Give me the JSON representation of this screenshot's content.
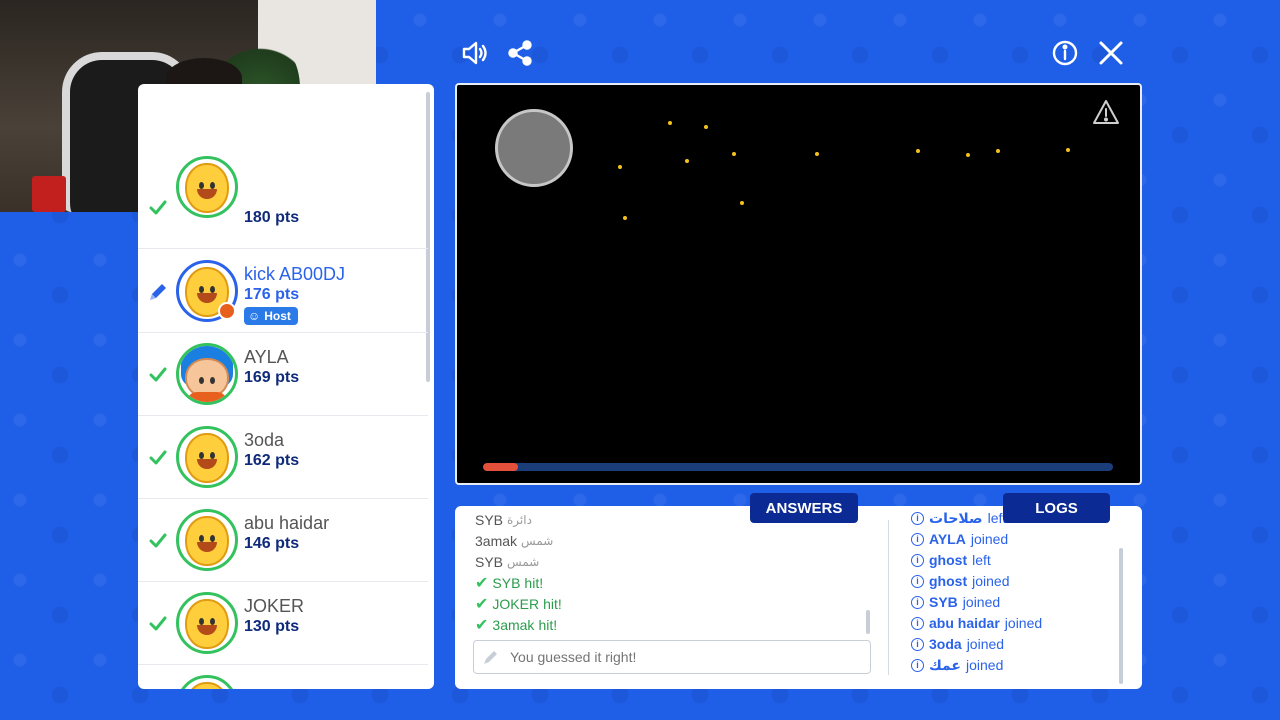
{
  "colors": {
    "background": "#1f5fe8",
    "accent": "#2a63ea",
    "correct": "#33c25e",
    "tab_bg": "#0c2a93",
    "points": "#0f2a7a",
    "timer_fill": "#e4503a"
  },
  "toolbar": {
    "left_icons": [
      "volume-icon",
      "share-icon"
    ],
    "right_icons": [
      "info-icon",
      "close-icon"
    ]
  },
  "players": [
    {
      "name": "",
      "points": "180 pts",
      "status": "correct",
      "dot": "gray"
    },
    {
      "name": "kick AB00DJ",
      "points": "176 pts",
      "status": "drawing",
      "dot": "orange",
      "badge": "Host",
      "is_me": true
    },
    {
      "name": "AYLA",
      "points": "169 pts",
      "status": "correct"
    },
    {
      "name": "3oda",
      "points": "162 pts",
      "status": "correct"
    },
    {
      "name": "abu haidar",
      "points": "146 pts",
      "status": "correct"
    },
    {
      "name": "JOKER",
      "points": "130 pts",
      "status": "correct"
    }
  ],
  "canvas": {
    "timer_progress": 0.055,
    "warning_icon": "warning-icon"
  },
  "tabs": {
    "answers": "ANSWERS",
    "logs": "LOGS"
  },
  "answers": [
    {
      "name": "SYB",
      "text": "دائرة"
    },
    {
      "name": "3amak",
      "text": "شمس"
    },
    {
      "name": "SYB",
      "text": "شمس"
    },
    {
      "name": "SYB",
      "text": "hit!",
      "hit": true
    },
    {
      "name": "JOKER",
      "text": "hit!",
      "hit": true
    },
    {
      "name": "3amak",
      "text": "hit!",
      "hit": true
    }
  ],
  "chat": {
    "placeholder": "You guessed it right!"
  },
  "logs": [
    {
      "name": "صلاحات",
      "action": "left"
    },
    {
      "name": "AYLA",
      "action": "joined"
    },
    {
      "name": "ghost",
      "action": "left"
    },
    {
      "name": "ghost",
      "action": "joined"
    },
    {
      "name": "SYB",
      "action": "joined"
    },
    {
      "name": "abu haidar",
      "action": "joined"
    },
    {
      "name": "3oda",
      "action": "joined"
    },
    {
      "name": "عمك",
      "action": "joined"
    }
  ]
}
